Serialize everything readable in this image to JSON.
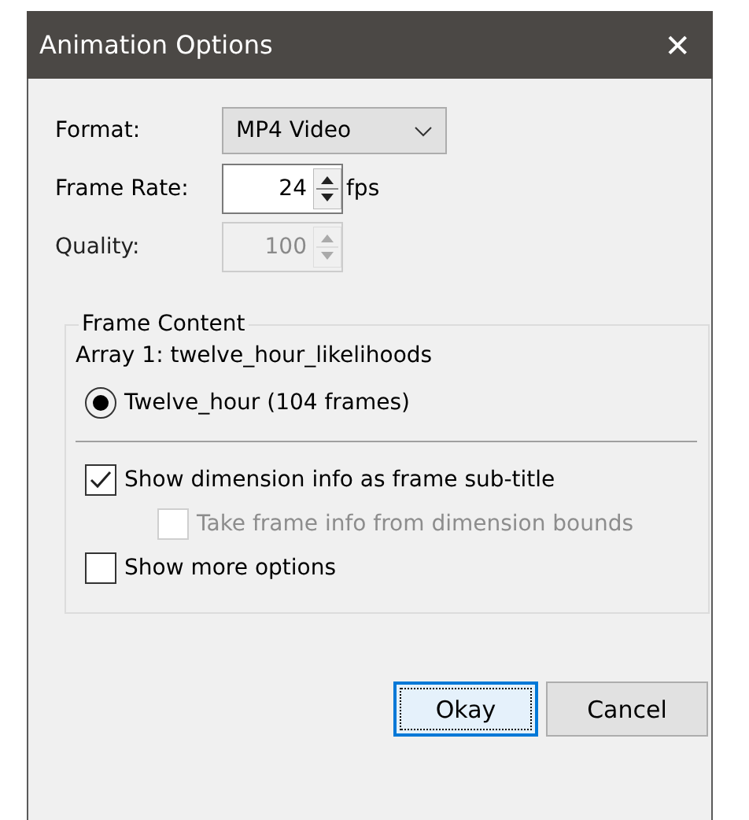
{
  "window": {
    "title": "Animation Options",
    "close": "✕"
  },
  "format": {
    "label": "Format:",
    "value": "MP4 Video"
  },
  "frame_rate": {
    "label": "Frame Rate:",
    "value": "24",
    "unit": "fps",
    "disabled": false
  },
  "quality": {
    "label": "Quality:",
    "value": "100",
    "disabled": true
  },
  "frame_content": {
    "title": "Frame Content",
    "array_label": "Array 1: twelve_hour_likelihoods",
    "radios": [
      {
        "label": "Twelve_hour (104 frames)",
        "selected": true
      }
    ],
    "checkboxes": [
      {
        "label": "Show dimension info as frame sub-title",
        "checked": true,
        "disabled": false,
        "children": [
          {
            "label": "Take frame info from dimension bounds",
            "checked": false,
            "disabled": true
          }
        ]
      },
      {
        "label": "Show more options",
        "checked": false,
        "disabled": false
      }
    ]
  },
  "buttons": [
    {
      "label": "Okay",
      "focused": true
    },
    {
      "label": "Cancel",
      "focused": false
    }
  ]
}
